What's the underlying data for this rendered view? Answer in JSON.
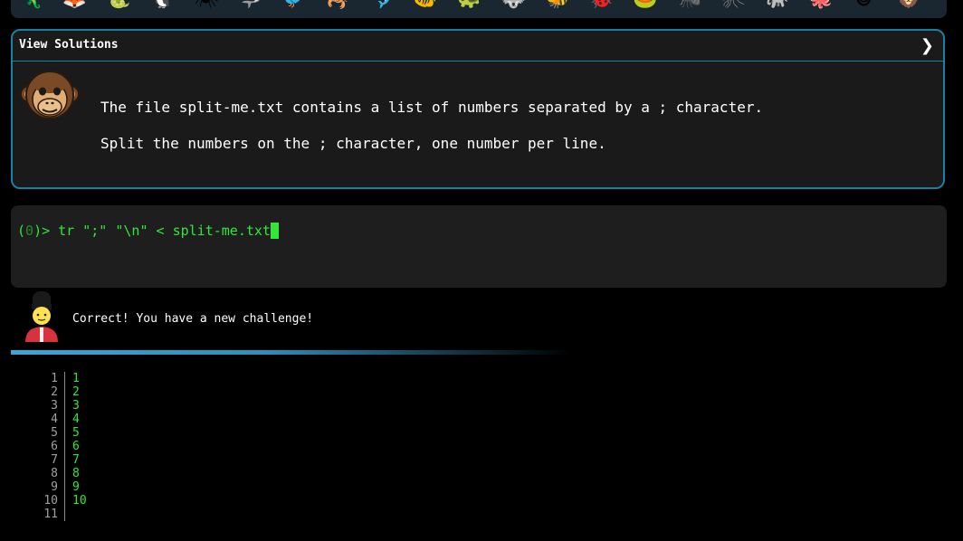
{
  "top_strip": {
    "icons": [
      {
        "name": "lizard-icon",
        "glyph": "🦎"
      },
      {
        "name": "fox-icon",
        "glyph": "🦊"
      },
      {
        "name": "snake-icon",
        "glyph": "🐍"
      },
      {
        "name": "penguin-icon",
        "glyph": "🐧"
      },
      {
        "name": "spider-icon",
        "glyph": "🕷"
      },
      {
        "name": "shark-icon",
        "glyph": "🦈"
      },
      {
        "name": "bird-icon",
        "glyph": "🐦"
      },
      {
        "name": "scorpion-icon",
        "glyph": "🦂"
      },
      {
        "name": "dolphin-icon",
        "glyph": "🐬"
      },
      {
        "name": "fish-icon",
        "glyph": "🐠"
      },
      {
        "name": "turtle-icon",
        "glyph": "🐢"
      },
      {
        "name": "wolf-icon",
        "glyph": "🐺"
      },
      {
        "name": "bee-icon",
        "glyph": "🐝"
      },
      {
        "name": "ladybug-icon",
        "glyph": "🐞"
      },
      {
        "name": "frog-icon",
        "glyph": "🐸"
      },
      {
        "name": "ant-icon",
        "glyph": "🐜"
      },
      {
        "name": "mosquito-icon",
        "glyph": "🦟"
      },
      {
        "name": "elephant-icon",
        "glyph": "🐘"
      },
      {
        "name": "octopus-icon",
        "glyph": "🐙"
      },
      {
        "name": "monkey-face-icon",
        "glyph": "🐵"
      },
      {
        "name": "lion-icon",
        "glyph": "🦁"
      }
    ]
  },
  "challenge": {
    "header_label": "View Solutions",
    "line1": "The file split-me.txt contains a list of numbers separated by a ; character.",
    "line2": "Split the numbers on the ; character, one number per line."
  },
  "terminal": {
    "prompt_open": "(",
    "prompt_index": "0",
    "prompt_close": ")> ",
    "command": "tr \";\" \"\\n\" < split-me.txt"
  },
  "feedback": {
    "message": "Correct! You have a new challenge!"
  },
  "output": {
    "rows": [
      {
        "num": "1",
        "val": "1"
      },
      {
        "num": "2",
        "val": "2"
      },
      {
        "num": "3",
        "val": "3"
      },
      {
        "num": "4",
        "val": "4"
      },
      {
        "num": "5",
        "val": "5"
      },
      {
        "num": "6",
        "val": "6"
      },
      {
        "num": "7",
        "val": "7"
      },
      {
        "num": "8",
        "val": "8"
      },
      {
        "num": "9",
        "val": "9"
      },
      {
        "num": "10",
        "val": "10"
      },
      {
        "num": "11",
        "val": ""
      }
    ]
  },
  "colors": {
    "accent": "#1a7fa5",
    "terminal_green": "#2ee83a",
    "card_bg": "#1a1a1a",
    "terminal_bg": "#1e1e1e",
    "progress": "#3aa7d6"
  }
}
